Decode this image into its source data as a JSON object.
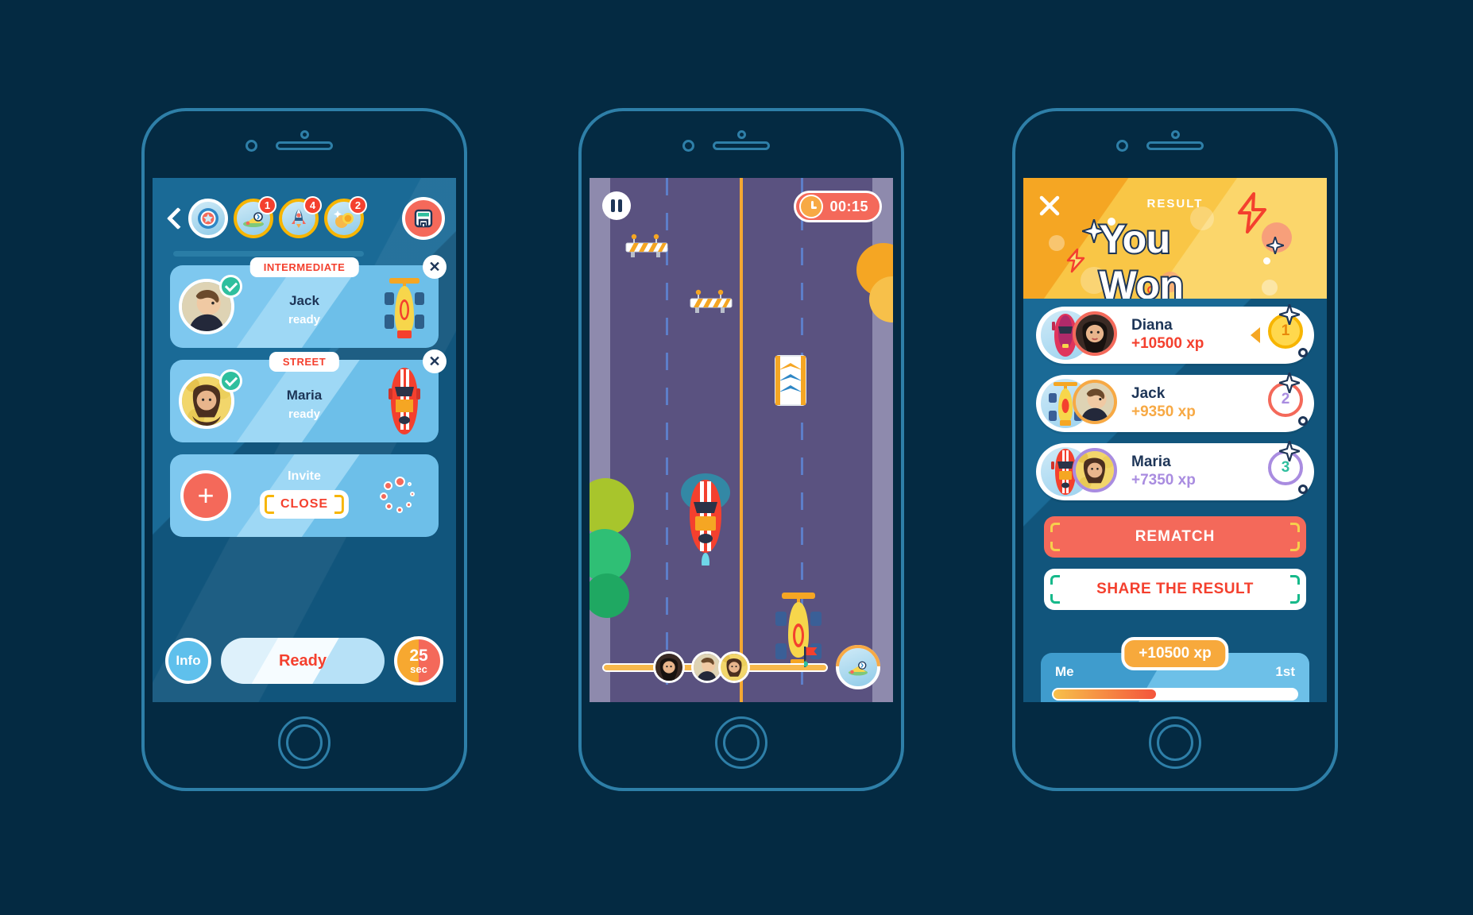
{
  "colors": {
    "page_bg": "#042a42",
    "frame_stroke": "#2e7fa8",
    "accent_red": "#f4402e",
    "accent_orange": "#f5a623",
    "accent_blue": "#5fc0ec",
    "road": "#5a5280",
    "green_check": "#2fbf9e",
    "purple": "#a98ce0"
  },
  "lobby": {
    "back_icon": "chevron-left-icon",
    "tokens": [
      {
        "icon": "shield-star-icon",
        "badge": ""
      },
      {
        "icon": "racing-flag-icon",
        "badge": "1"
      },
      {
        "icon": "rocket-icon",
        "badge": "4"
      },
      {
        "icon": "coins-icon",
        "badge": "2"
      }
    ],
    "shop_icon": "garage-shop-icon",
    "players": [
      {
        "tag": "INTERMEDIATE",
        "name": "Jack",
        "state": "ready",
        "car": "formula-yellow",
        "checked": true,
        "close": "✕"
      },
      {
        "tag": "STREET",
        "name": "Maria",
        "state": "ready",
        "car": "street-red",
        "checked": true,
        "close": "✕"
      }
    ],
    "invite": {
      "plus_label": "+",
      "title": "Invite",
      "close_label": "CLOSE",
      "spinner_icon": "loading-dots-icon"
    },
    "footer": {
      "info_label": "Info",
      "ready_label": "Ready",
      "timer_value": "25",
      "timer_unit": "sec"
    }
  },
  "race": {
    "pause_icon": "pause-icon",
    "timer": "00:15",
    "clock_icon": "clock-icon",
    "obstacles": [
      "road-barrier",
      "road-barrier",
      "road-chevron-sign"
    ],
    "cars": [
      {
        "name": "street-red-car",
        "player": "me"
      },
      {
        "name": "formula-yellow-car",
        "player": "opponent"
      }
    ],
    "progress": {
      "avatars": [
        "diana",
        "jack",
        "maria"
      ],
      "flag_icon": "finish-flag-icon",
      "end_icon": "racing-flag-icon"
    }
  },
  "result": {
    "close_icon": "close-icon",
    "label": "RESULT",
    "title": "You Won",
    "rows": [
      {
        "name": "Diana",
        "xp": "+10500 xp",
        "place": "1",
        "car": "street-pink",
        "leader": true
      },
      {
        "name": "Jack",
        "xp": "+9350 xp",
        "place": "2",
        "car": "formula-yellow",
        "leader": false
      },
      {
        "name": "Maria",
        "xp": "+7350 xp",
        "place": "3",
        "car": "street-red",
        "leader": false
      }
    ],
    "rematch_label": "REMATCH",
    "share_label": "SHARE THE RESULT",
    "me_bar": {
      "me_label": "Me",
      "place_label": "1st",
      "xp_pill": "+10500 xp",
      "progress_percent": 43
    }
  }
}
